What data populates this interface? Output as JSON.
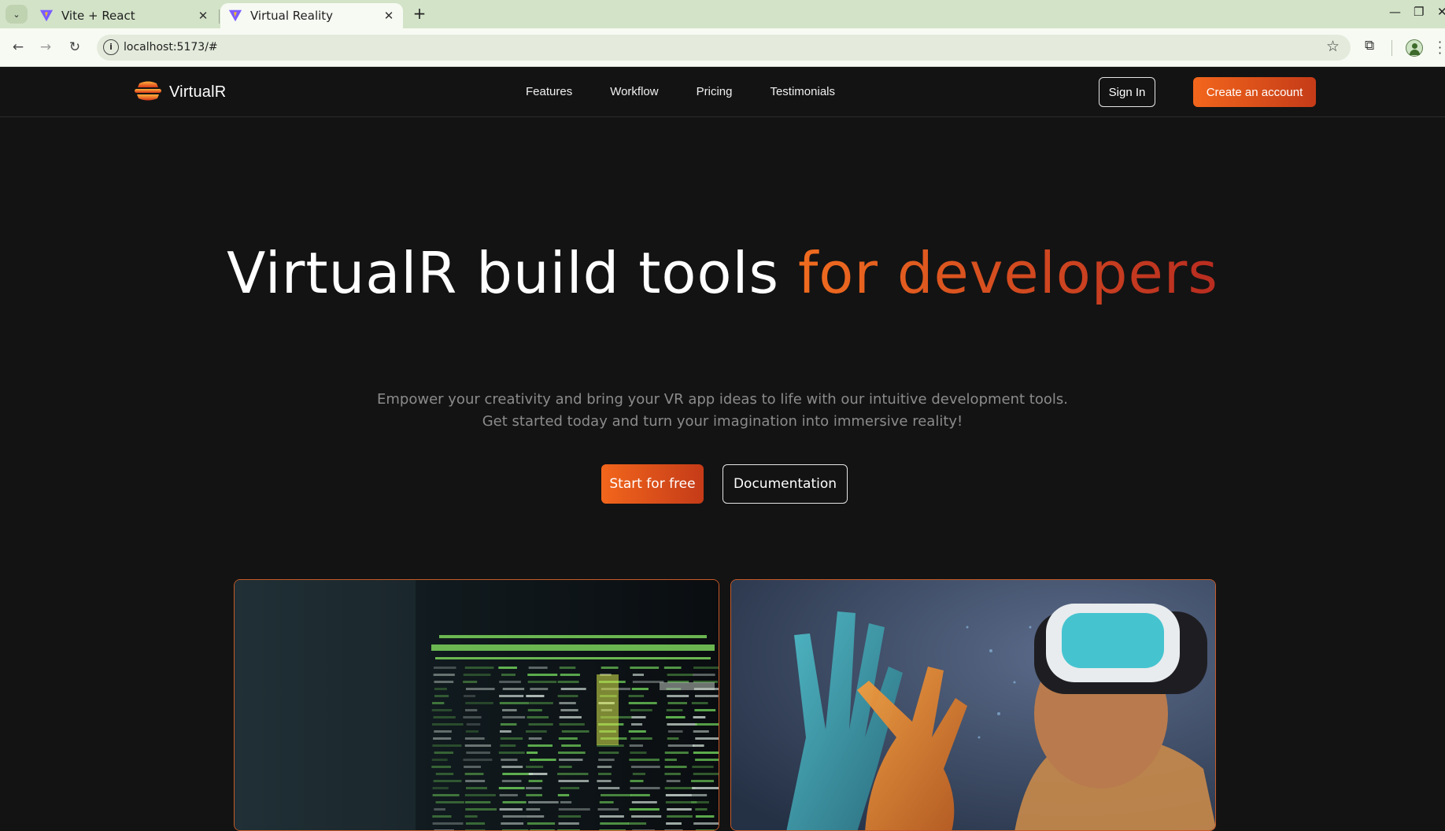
{
  "browser": {
    "tabs": [
      {
        "title": "Vite + React",
        "active": false
      },
      {
        "title": "Virtual Reality",
        "active": true
      }
    ],
    "url": "localhost:5173/#"
  },
  "nav": {
    "brand": "VirtualR",
    "links": [
      "Features",
      "Workflow",
      "Pricing",
      "Testimonials"
    ],
    "sign_in": "Sign In",
    "create_account": "Create an account"
  },
  "hero": {
    "title_main": "VirtualR build tools ",
    "title_accent": "for developers",
    "subtitle_line1": "Empower your creativity and bring your VR app ideas to life with our intuitive development tools.",
    "subtitle_line2": "Get started today and turn your imagination into immersive reality!",
    "primary_cta": "Start for free",
    "secondary_cta": "Documentation"
  },
  "media": [
    {
      "name": "terminal-code-image"
    },
    {
      "name": "vr-headset-person-image"
    }
  ],
  "colors": {
    "accent_start": "#f2661c",
    "accent_end": "#c53b18",
    "background": "#131313"
  }
}
